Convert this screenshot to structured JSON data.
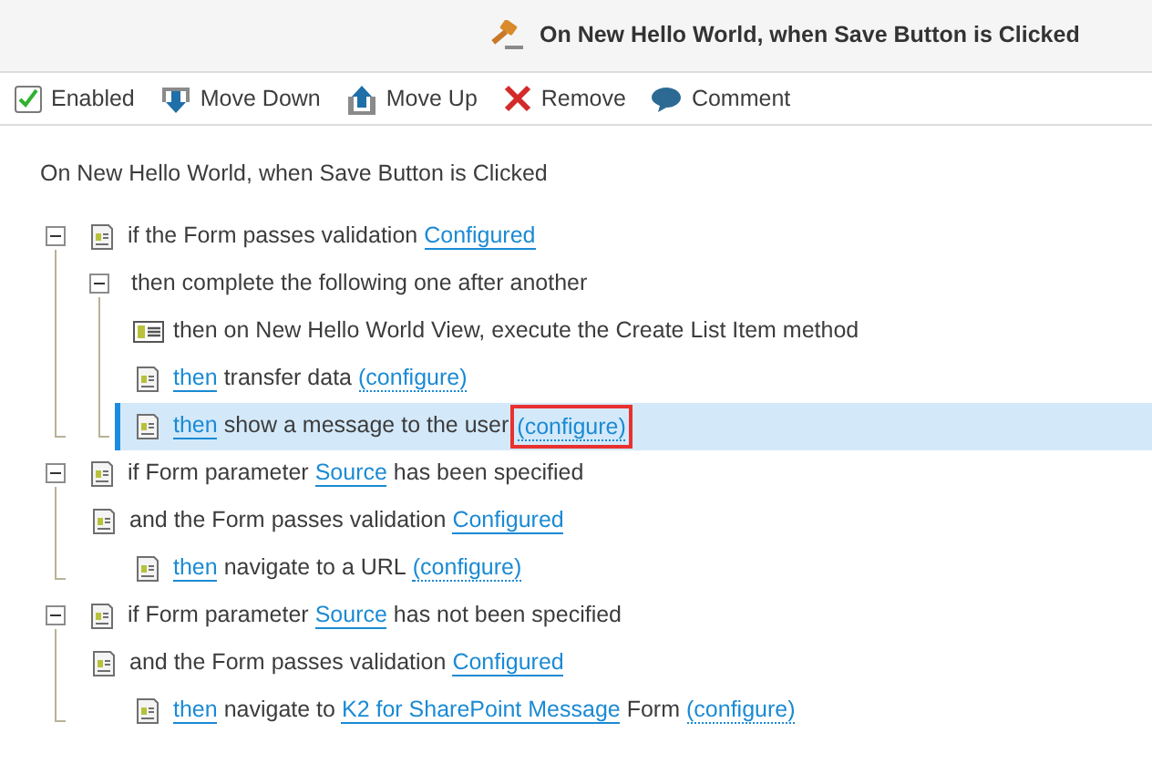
{
  "header": {
    "title": "On New Hello World, when Save Button is Clicked"
  },
  "toolbar": [
    {
      "kind": "checkbox",
      "label": "Enabled",
      "checked": true
    },
    {
      "kind": "move-down",
      "label": "Move Down"
    },
    {
      "kind": "move-up",
      "label": "Move Up"
    },
    {
      "kind": "remove",
      "label": "Remove"
    },
    {
      "kind": "comment",
      "label": "Comment"
    }
  ],
  "rule_title": "On New Hello World, when Save Button is Clicked",
  "rules": [
    {
      "kind": "rule",
      "expanded": true,
      "selected": false,
      "parts": [
        {
          "kind": "text",
          "text": "if the Form passes validation"
        },
        {
          "kind": "link",
          "text": "Configured"
        }
      ],
      "children": [
        {
          "kind": "group",
          "expanded": true,
          "selected": false,
          "parts": [
            {
              "kind": "text",
              "text": "then complete the following one after another"
            }
          ],
          "children": [
            {
              "kind": "method-action",
              "selected": false,
              "parts": [
                {
                  "kind": "text",
                  "text": "then on New Hello World View, execute the Create List Item method"
                }
              ]
            },
            {
              "kind": "action",
              "selected": false,
              "parts": [
                {
                  "kind": "link",
                  "text": "then"
                },
                {
                  "kind": "text",
                  "text": "transfer data"
                },
                {
                  "kind": "dotted-link",
                  "text": "(configure)"
                }
              ]
            },
            {
              "kind": "action",
              "selected": true,
              "parts": [
                {
                  "kind": "link",
                  "text": "then"
                },
                {
                  "kind": "text",
                  "text": "show a message to the user"
                },
                {
                  "kind": "dotted-link",
                  "text": "(configure)",
                  "outlined": true
                }
              ]
            }
          ]
        }
      ]
    },
    {
      "kind": "rule",
      "expanded": true,
      "selected": false,
      "parts": [
        {
          "kind": "text",
          "text": "if Form parameter"
        },
        {
          "kind": "link",
          "text": "Source"
        },
        {
          "kind": "text",
          "text": "has been specified"
        }
      ],
      "children": [
        {
          "kind": "condition",
          "selected": false,
          "parts": [
            {
              "kind": "text",
              "text": "and the Form passes validation"
            },
            {
              "kind": "link",
              "text": "Configured"
            }
          ],
          "children": [
            {
              "kind": "action",
              "selected": false,
              "parts": [
                {
                  "kind": "link",
                  "text": "then"
                },
                {
                  "kind": "text",
                  "text": "navigate to a URL"
                },
                {
                  "kind": "dotted-link",
                  "text": "(configure)"
                }
              ]
            }
          ]
        }
      ]
    },
    {
      "kind": "rule",
      "expanded": true,
      "selected": false,
      "parts": [
        {
          "kind": "text",
          "text": "if Form parameter"
        },
        {
          "kind": "link",
          "text": "Source"
        },
        {
          "kind": "text",
          "text": "has not been specified"
        }
      ],
      "children": [
        {
          "kind": "condition",
          "selected": false,
          "parts": [
            {
              "kind": "text",
              "text": "and the Form passes validation"
            },
            {
              "kind": "link",
              "text": "Configured"
            }
          ],
          "children": [
            {
              "kind": "action",
              "selected": false,
              "parts": [
                {
                  "kind": "link",
                  "text": "then"
                },
                {
                  "kind": "text",
                  "text": "navigate to"
                },
                {
                  "kind": "link",
                  "text": "K2 for SharePoint Message"
                },
                {
                  "kind": "text",
                  "text": "Form"
                },
                {
                  "kind": "dotted-link",
                  "text": "(configure)"
                }
              ]
            }
          ]
        }
      ]
    }
  ]
}
